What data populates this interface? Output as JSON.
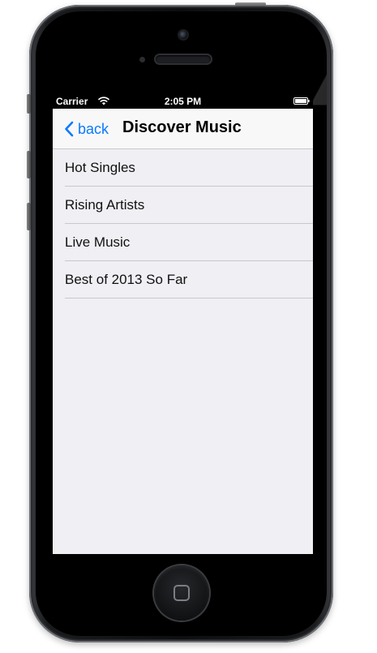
{
  "status_bar": {
    "carrier": "Carrier",
    "time": "2:05 PM",
    "wifi_icon": "wifi-icon",
    "battery_icon": "battery-icon"
  },
  "nav_bar": {
    "back_label": "back",
    "back_icon": "chevron-left-icon",
    "title": "Discover Music"
  },
  "list": {
    "items": [
      {
        "label": "Hot Singles"
      },
      {
        "label": "Rising Artists"
      },
      {
        "label": "Live Music"
      },
      {
        "label": "Best of 2013 So Far"
      }
    ]
  },
  "colors": {
    "accent": "#0a7aff",
    "background": "#efeff4",
    "nav_background": "#f8f8f8",
    "separator": "#c8c7cc"
  }
}
